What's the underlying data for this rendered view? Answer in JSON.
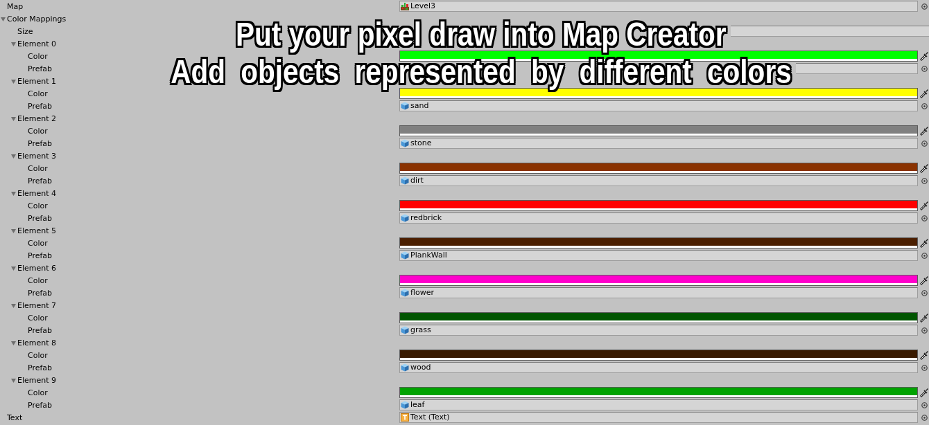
{
  "map": {
    "label": "Map",
    "value": {
      "kind": "texture",
      "text": "Level3"
    }
  },
  "color_mappings": {
    "label": "Color Mappings",
    "expanded": true,
    "size": {
      "label": "Size"
    },
    "elements": [
      {
        "label": "Element 0",
        "expanded": true,
        "color_label": "Color",
        "color": "#00ff00",
        "prefab_label": "Prefab"
      },
      {
        "label": "Element 1",
        "expanded": true,
        "color_label": "Color",
        "color": "#ffff00",
        "prefab_label": "Prefab",
        "prefab": {
          "kind": "prefab",
          "text": "sand"
        }
      },
      {
        "label": "Element 2",
        "expanded": true,
        "color_label": "Color",
        "color": "#808080",
        "prefab_label": "Prefab",
        "prefab": {
          "kind": "prefab",
          "text": "stone"
        }
      },
      {
        "label": "Element 3",
        "expanded": true,
        "color_label": "Color",
        "color": "#8a3200",
        "prefab_label": "Prefab",
        "prefab": {
          "kind": "prefab",
          "text": "dirt"
        }
      },
      {
        "label": "Element 4",
        "expanded": true,
        "color_label": "Color",
        "color": "#ff0000",
        "prefab_label": "Prefab",
        "prefab": {
          "kind": "prefab",
          "text": "redbrick"
        }
      },
      {
        "label": "Element 5",
        "expanded": true,
        "color_label": "Color",
        "color": "#4b1f00",
        "prefab_label": "Prefab",
        "prefab": {
          "kind": "prefab",
          "text": "PlankWall"
        }
      },
      {
        "label": "Element 6",
        "expanded": true,
        "color_label": "Color",
        "color": "#ff00cc",
        "prefab_label": "Prefab",
        "prefab": {
          "kind": "prefab",
          "text": "flower"
        }
      },
      {
        "label": "Element 7",
        "expanded": true,
        "color_label": "Color",
        "color": "#005500",
        "prefab_label": "Prefab",
        "prefab": {
          "kind": "prefab",
          "text": "grass"
        }
      },
      {
        "label": "Element 8",
        "expanded": true,
        "color_label": "Color",
        "color": "#391a00",
        "prefab_label": "Prefab",
        "prefab": {
          "kind": "prefab",
          "text": "wood"
        }
      },
      {
        "label": "Element 9",
        "expanded": true,
        "color_label": "Color",
        "color": "#00a300",
        "prefab_label": "Prefab",
        "prefab": {
          "kind": "prefab",
          "text": "leaf"
        }
      }
    ]
  },
  "text": {
    "label": "Text",
    "value": {
      "kind": "text",
      "text": "Text (Text)"
    }
  },
  "caption": {
    "lines": [
      "Put your pixel draw into Map Creator",
      "Add objects represented by different colors"
    ]
  }
}
